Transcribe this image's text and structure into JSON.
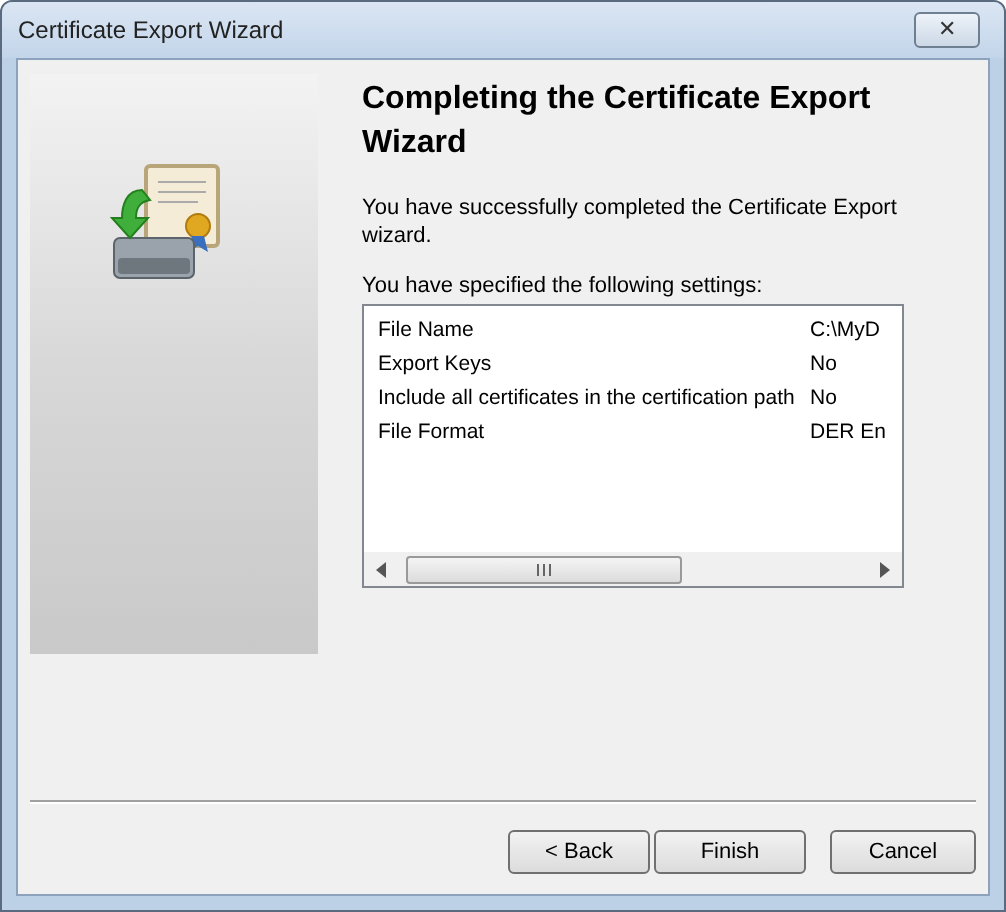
{
  "window": {
    "title": "Certificate Export Wizard",
    "close_glyph": "✕"
  },
  "heading": "Completing the Certificate Export Wizard",
  "intro": "You have successfully completed the Certificate Export wizard.",
  "settings_label": "You have specified the following settings:",
  "settings": [
    {
      "name": "File Name",
      "value": "C:\\MyD"
    },
    {
      "name": "Export Keys",
      "value": "No"
    },
    {
      "name": "Include all certificates in the certification path",
      "value": "No"
    },
    {
      "name": "File Format",
      "value": "DER En"
    }
  ],
  "buttons": [
    {
      "label": "< Back",
      "kind": "back"
    },
    {
      "label": "Finish",
      "kind": "finish"
    },
    {
      "label": "Cancel",
      "kind": "cancel"
    }
  ]
}
